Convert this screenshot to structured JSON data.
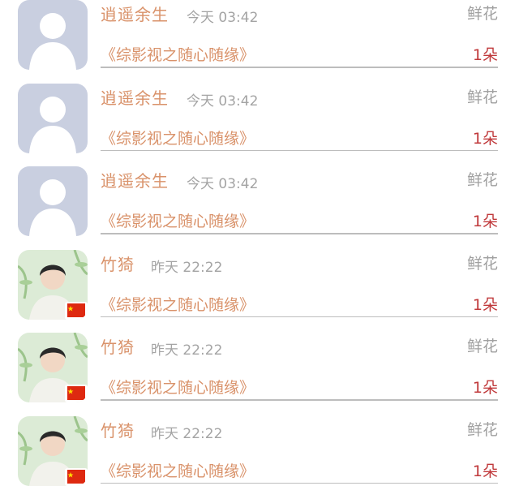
{
  "colors": {
    "username": "#d9926a",
    "time": "#a4a4a4",
    "gift_type": "#a0a0a0",
    "book_title": "#d9926a",
    "count": "#c0393b",
    "divider": "#bdbdbd"
  },
  "records": [
    {
      "username": "逍遥余生",
      "time": "今天 03:42",
      "gift_type": "鲜花",
      "book_title": "《综影视之随心随缘》",
      "count": "1朵",
      "avatar_icon": "default-user-avatar-icon"
    },
    {
      "username": "逍遥余生",
      "time": "今天 03:42",
      "gift_type": "鲜花",
      "book_title": "《综影视之随心随缘》",
      "count": "1朵",
      "avatar_icon": "default-user-avatar-icon"
    },
    {
      "username": "逍遥余生",
      "time": "今天 03:42",
      "gift_type": "鲜花",
      "book_title": "《综影视之随心随缘》",
      "count": "1朵",
      "avatar_icon": "default-user-avatar-icon"
    },
    {
      "username": "竹猗",
      "time": "昨天 22:22",
      "gift_type": "鲜花",
      "book_title": "《综影视之随心随缘》",
      "count": "1朵",
      "avatar_icon": "photo-avatar-icon"
    },
    {
      "username": "竹猗",
      "time": "昨天 22:22",
      "gift_type": "鲜花",
      "book_title": "《综影视之随心随缘》",
      "count": "1朵",
      "avatar_icon": "photo-avatar-icon"
    },
    {
      "username": "竹猗",
      "time": "昨天 22:22",
      "gift_type": "鲜花",
      "book_title": "《综影视之随心随缘》",
      "count": "1朵",
      "avatar_icon": "photo-avatar-icon"
    }
  ]
}
